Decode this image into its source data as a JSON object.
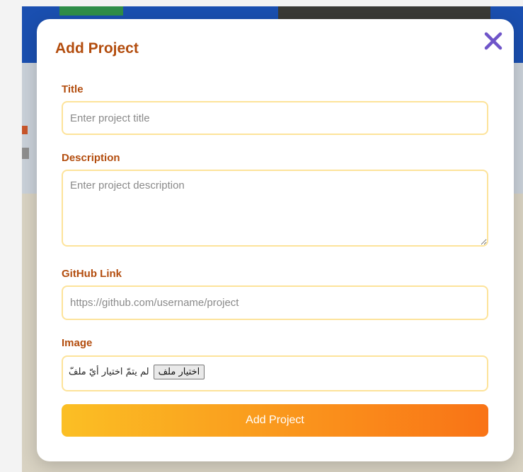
{
  "modal": {
    "title": "Add Project",
    "close_icon": "close-icon"
  },
  "form": {
    "title": {
      "label": "Title",
      "placeholder": "Enter project title"
    },
    "description": {
      "label": "Description",
      "placeholder": "Enter project description"
    },
    "github": {
      "label": "GitHub Link",
      "placeholder": "https://github.com/username/project"
    },
    "image": {
      "label": "Image",
      "button_label": "اختيار ملف",
      "status_text": "لم يتمّ اختيار أيّ ملفّ"
    },
    "submit_label": "Add Project"
  },
  "colors": {
    "label": "#b34d0e",
    "input_border": "#fde39a",
    "close_icon": "#6f55c9",
    "button_gradient_start": "#fbbf24",
    "button_gradient_end": "#f97316"
  }
}
